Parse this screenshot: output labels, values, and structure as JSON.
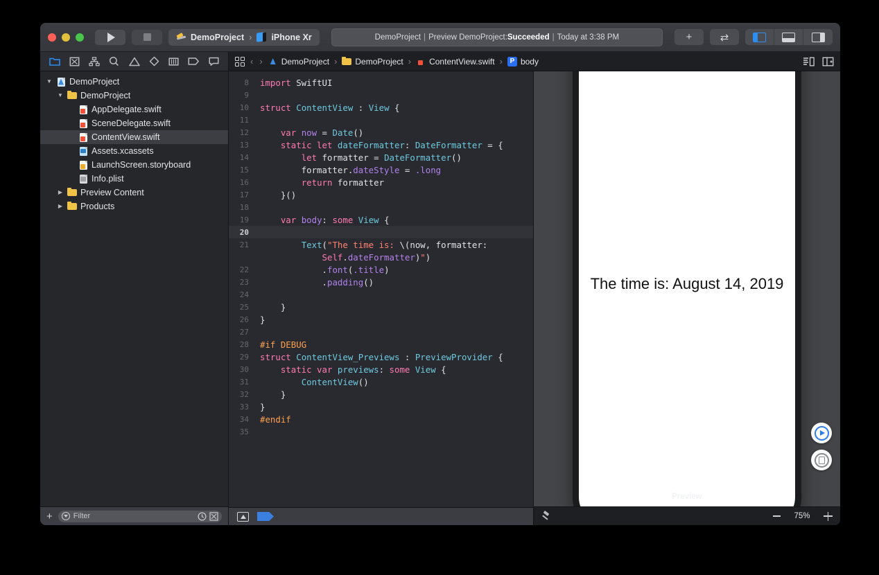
{
  "window": {
    "traffic_lights": [
      "close",
      "minimize",
      "zoom"
    ],
    "run_button": "run",
    "stop_button": "stop"
  },
  "toolbar": {
    "scheme_name": "DemoProject",
    "scheme_separator": "›",
    "destination": "iPhone Xr",
    "status": {
      "project": "DemoProject",
      "sep": "|",
      "action": "Preview DemoProject:",
      "result": "Succeeded",
      "time": "Today at 3:38 PM",
      "full": "DemoProject | Preview DemoProject: Succeeded | Today at 3:38 PM"
    },
    "add_label": "+",
    "swap_label": "⇄",
    "panels": [
      {
        "name": "navigator",
        "active": true
      },
      {
        "name": "debug-area",
        "active": false
      },
      {
        "name": "inspector",
        "active": false
      }
    ],
    "accent_blue": "#2b8ef0"
  },
  "navigator": {
    "tabs": [
      {
        "name": "project-navigator",
        "icon": "folder-icon",
        "active": true
      },
      {
        "name": "source-control-navigator",
        "icon": "source-control-icon",
        "active": false
      },
      {
        "name": "symbol-navigator",
        "icon": "hierarchy-icon",
        "active": false
      },
      {
        "name": "find-navigator",
        "icon": "search-icon",
        "active": false
      },
      {
        "name": "issue-navigator",
        "icon": "warning-icon",
        "active": false
      },
      {
        "name": "test-navigator",
        "icon": "diamond-icon",
        "active": false
      },
      {
        "name": "debug-navigator",
        "icon": "gauge-icon",
        "active": false
      },
      {
        "name": "breakpoint-navigator",
        "icon": "breakpoint-icon",
        "active": false
      },
      {
        "name": "report-navigator",
        "icon": "speech-bubble-icon",
        "active": false
      }
    ],
    "tree": [
      {
        "label": "DemoProject",
        "indent": 0,
        "twisty": "open",
        "icon": "proj",
        "selected": false
      },
      {
        "label": "DemoProject",
        "indent": 1,
        "twisty": "open",
        "icon": "folder",
        "selected": false
      },
      {
        "label": "AppDelegate.swift",
        "indent": 2,
        "twisty": "none",
        "icon": "swift",
        "selected": false
      },
      {
        "label": "SceneDelegate.swift",
        "indent": 2,
        "twisty": "none",
        "icon": "swift",
        "selected": false
      },
      {
        "label": "ContentView.swift",
        "indent": 2,
        "twisty": "none",
        "icon": "swift",
        "selected": true
      },
      {
        "label": "Assets.xcassets",
        "indent": 2,
        "twisty": "none",
        "icon": "assets",
        "selected": false
      },
      {
        "label": "LaunchScreen.storyboard",
        "indent": 2,
        "twisty": "none",
        "icon": "story",
        "selected": false
      },
      {
        "label": "Info.plist",
        "indent": 2,
        "twisty": "none",
        "icon": "plist",
        "selected": false
      },
      {
        "label": "Preview Content",
        "indent": 1,
        "twisty": "closed",
        "icon": "folder",
        "selected": false
      },
      {
        "label": "Products",
        "indent": 1,
        "twisty": "closed",
        "icon": "folder",
        "selected": false
      }
    ],
    "bottom": {
      "add_label": "+",
      "filter_placeholder": "Filter",
      "recent_icon": "clock-icon",
      "source-control_icon": "scm-filter-icon"
    }
  },
  "jump_bar": {
    "related_items_icon": "related-items-icon",
    "back_label": "‹",
    "forward_label": "›",
    "crumbs": [
      {
        "label": "DemoProject",
        "icon": "project-icon"
      },
      {
        "label": "DemoProject",
        "icon": "folder-icon"
      },
      {
        "label": "ContentView.swift",
        "icon": "swift-file-icon"
      },
      {
        "label": "body",
        "icon": "property-badge",
        "badge": "P"
      }
    ],
    "right_icons": [
      "minimap-icon",
      "add-editor-icon"
    ]
  },
  "editor": {
    "lines": [
      {
        "n": "8",
        "tokens": [
          {
            "t": "import",
            "c": "kw"
          },
          {
            "t": " SwiftUI",
            "c": "pln"
          }
        ]
      },
      {
        "n": "9",
        "tokens": []
      },
      {
        "n": "10",
        "tokens": [
          {
            "t": "struct",
            "c": "kw"
          },
          {
            "t": " ",
            "c": "pln"
          },
          {
            "t": "ContentView",
            "c": "typ"
          },
          {
            "t": " : ",
            "c": "pln"
          },
          {
            "t": "View",
            "c": "typ"
          },
          {
            "t": " {",
            "c": "pln"
          }
        ]
      },
      {
        "n": "11",
        "tokens": []
      },
      {
        "n": "12",
        "tokens": [
          {
            "t": "    ",
            "c": "pln"
          },
          {
            "t": "var",
            "c": "kw"
          },
          {
            "t": " ",
            "c": "pln"
          },
          {
            "t": "now",
            "c": "prop"
          },
          {
            "t": " = ",
            "c": "pln"
          },
          {
            "t": "Date",
            "c": "typ"
          },
          {
            "t": "()",
            "c": "pln"
          }
        ]
      },
      {
        "n": "13",
        "tokens": [
          {
            "t": "    ",
            "c": "pln"
          },
          {
            "t": "static let",
            "c": "kw"
          },
          {
            "t": " ",
            "c": "pln"
          },
          {
            "t": "dateFormatter",
            "c": "typ"
          },
          {
            "t": ": ",
            "c": "pln"
          },
          {
            "t": "DateFormatter",
            "c": "typ"
          },
          {
            "t": " = {",
            "c": "pln"
          }
        ]
      },
      {
        "n": "14",
        "tokens": [
          {
            "t": "        ",
            "c": "pln"
          },
          {
            "t": "let",
            "c": "kw"
          },
          {
            "t": " formatter = ",
            "c": "pln"
          },
          {
            "t": "DateFormatter",
            "c": "typ"
          },
          {
            "t": "()",
            "c": "pln"
          }
        ]
      },
      {
        "n": "15",
        "tokens": [
          {
            "t": "        formatter.",
            "c": "pln"
          },
          {
            "t": "dateStyle",
            "c": "prop"
          },
          {
            "t": " = ",
            "c": "pln"
          },
          {
            "t": ".long",
            "c": "prop"
          }
        ]
      },
      {
        "n": "16",
        "tokens": [
          {
            "t": "        ",
            "c": "pln"
          },
          {
            "t": "return",
            "c": "kw"
          },
          {
            "t": " formatter",
            "c": "pln"
          }
        ]
      },
      {
        "n": "17",
        "tokens": [
          {
            "t": "    }()",
            "c": "pln"
          }
        ]
      },
      {
        "n": "18",
        "tokens": []
      },
      {
        "n": "19",
        "tokens": [
          {
            "t": "    ",
            "c": "pln"
          },
          {
            "t": "var",
            "c": "kw"
          },
          {
            "t": " ",
            "c": "pln"
          },
          {
            "t": "body",
            "c": "prop"
          },
          {
            "t": ": ",
            "c": "pln"
          },
          {
            "t": "some",
            "c": "kw"
          },
          {
            "t": " ",
            "c": "pln"
          },
          {
            "t": "View",
            "c": "typ"
          },
          {
            "t": " {",
            "c": "pln"
          }
        ]
      },
      {
        "n": "20",
        "tokens": [],
        "highlight": true
      },
      {
        "n": "21",
        "tokens": [
          {
            "t": "        ",
            "c": "pln"
          },
          {
            "t": "Text",
            "c": "typ"
          },
          {
            "t": "(",
            "c": "pln"
          },
          {
            "t": "\"The time is: ",
            "c": "str"
          },
          {
            "t": "\\(",
            "c": "pln"
          },
          {
            "t": "now",
            "c": "pln"
          },
          {
            "t": ", formatter:",
            "c": "pln"
          }
        ]
      },
      {
        "n": "",
        "tokens": [
          {
            "t": "            ",
            "c": "pln"
          },
          {
            "t": "Self",
            "c": "kw"
          },
          {
            "t": ".",
            "c": "pln"
          },
          {
            "t": "dateFormatter",
            "c": "prop"
          },
          {
            "t": ")",
            "c": "pln"
          },
          {
            "t": "\"",
            "c": "str"
          },
          {
            "t": ")",
            "c": "pln"
          }
        ]
      },
      {
        "n": "22",
        "tokens": [
          {
            "t": "            .",
            "c": "pln"
          },
          {
            "t": "font",
            "c": "prop"
          },
          {
            "t": "(",
            "c": "pln"
          },
          {
            "t": ".title",
            "c": "prop"
          },
          {
            "t": ")",
            "c": "pln"
          }
        ]
      },
      {
        "n": "23",
        "tokens": [
          {
            "t": "            .",
            "c": "pln"
          },
          {
            "t": "padding",
            "c": "prop"
          },
          {
            "t": "()",
            "c": "pln"
          }
        ]
      },
      {
        "n": "24",
        "tokens": []
      },
      {
        "n": "25",
        "tokens": [
          {
            "t": "    }",
            "c": "pln"
          }
        ]
      },
      {
        "n": "26",
        "tokens": [
          {
            "t": "}",
            "c": "pln"
          }
        ]
      },
      {
        "n": "27",
        "tokens": []
      },
      {
        "n": "28",
        "tokens": [
          {
            "t": "#if DEBUG",
            "c": "pre"
          }
        ]
      },
      {
        "n": "29",
        "tokens": [
          {
            "t": "struct",
            "c": "kw"
          },
          {
            "t": " ",
            "c": "pln"
          },
          {
            "t": "ContentView_Previews",
            "c": "typ"
          },
          {
            "t": " : ",
            "c": "pln"
          },
          {
            "t": "PreviewProvider",
            "c": "typ"
          },
          {
            "t": " {",
            "c": "pln"
          }
        ]
      },
      {
        "n": "30",
        "tokens": [
          {
            "t": "    ",
            "c": "pln"
          },
          {
            "t": "static var",
            "c": "kw"
          },
          {
            "t": " ",
            "c": "pln"
          },
          {
            "t": "previews",
            "c": "typ"
          },
          {
            "t": ": ",
            "c": "pln"
          },
          {
            "t": "some",
            "c": "kw"
          },
          {
            "t": " ",
            "c": "pln"
          },
          {
            "t": "View",
            "c": "typ"
          },
          {
            "t": " {",
            "c": "pln"
          }
        ]
      },
      {
        "n": "31",
        "tokens": [
          {
            "t": "        ",
            "c": "pln"
          },
          {
            "t": "ContentView",
            "c": "typ"
          },
          {
            "t": "()",
            "c": "pln"
          }
        ]
      },
      {
        "n": "32",
        "tokens": [
          {
            "t": "    }",
            "c": "pln"
          }
        ]
      },
      {
        "n": "33",
        "tokens": [
          {
            "t": "}",
            "c": "pln"
          }
        ]
      },
      {
        "n": "34",
        "tokens": [
          {
            "t": "#endif",
            "c": "pre"
          }
        ]
      },
      {
        "n": "35",
        "tokens": []
      }
    ],
    "bottom_bar": {
      "debug_view_icon": "debug-view-hierarchy-icon",
      "breakpoint_icon": "breakpoint-toggle-icon"
    }
  },
  "canvas": {
    "preview_text": "The time is: August 14, 2019",
    "preview_label": "Preview",
    "live_preview_button": "live-preview",
    "inspect_button": "inspect-preview",
    "bottom": {
      "pin_icon": "pin-icon",
      "zoom_out": "—",
      "zoom_value": "75%",
      "zoom_in": "+"
    },
    "background_color": "#444548",
    "device_color": "#1b1c1e"
  }
}
